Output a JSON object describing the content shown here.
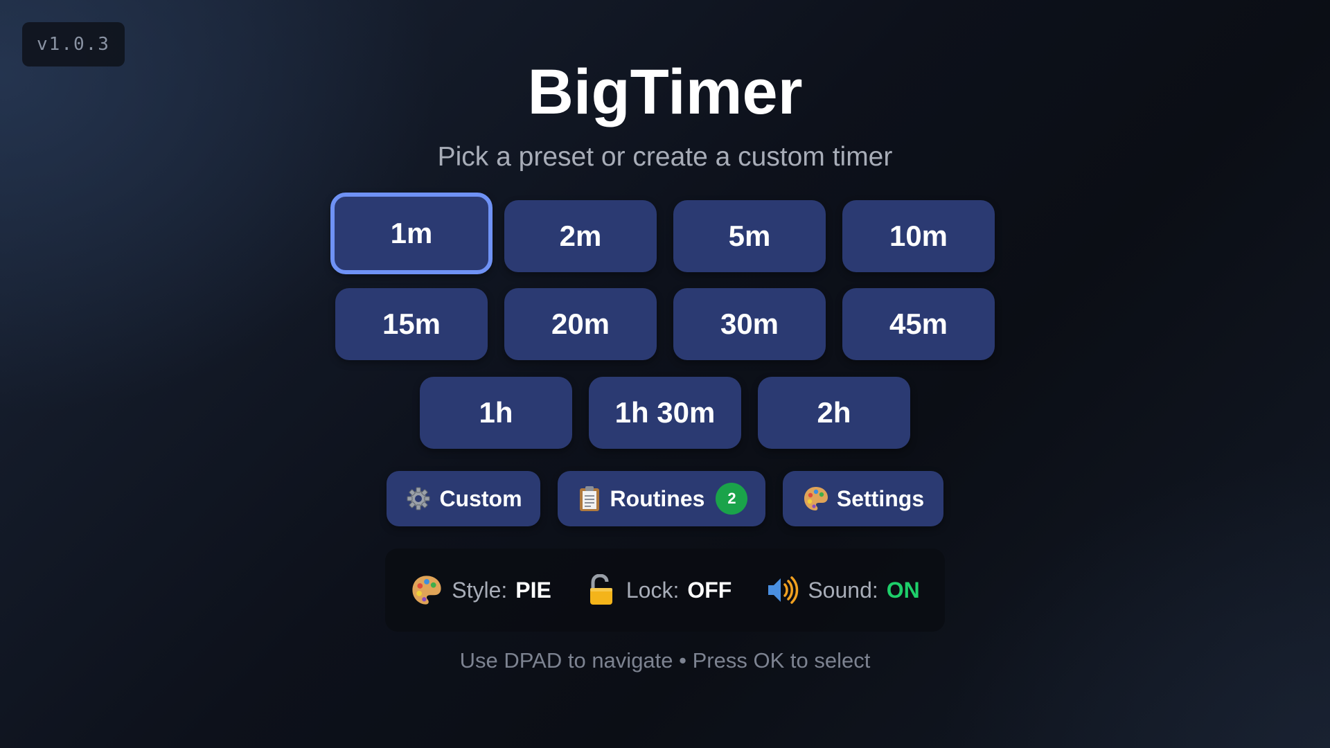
{
  "version": "v1.0.3",
  "header": {
    "title": "BigTimer",
    "subtitle": "Pick a preset or create a custom timer"
  },
  "presets": [
    {
      "label": "1m",
      "focused": true
    },
    {
      "label": "2m"
    },
    {
      "label": "5m"
    },
    {
      "label": "10m"
    },
    {
      "label": "15m"
    },
    {
      "label": "20m"
    },
    {
      "label": "30m"
    },
    {
      "label": "45m"
    },
    {
      "label": "1h"
    },
    {
      "label": "1h 30m"
    },
    {
      "label": "2h"
    }
  ],
  "actions": {
    "custom": {
      "label": "Custom",
      "icon": "gear-icon"
    },
    "routines": {
      "label": "Routines",
      "icon": "clipboard-icon",
      "count": "2"
    },
    "settings": {
      "label": "Settings",
      "icon": "palette-icon"
    }
  },
  "status": {
    "style": {
      "label": "Style:",
      "value": "PIE",
      "icon": "palette-icon"
    },
    "lock": {
      "label": "Lock:",
      "value": "OFF",
      "icon": "unlocked-padlock-icon"
    },
    "sound": {
      "label": "Sound:",
      "value": "ON",
      "icon": "speaker-icon"
    }
  },
  "hint": "Use DPAD to navigate • Press OK to select",
  "colors": {
    "button": "#2b3a72",
    "focus_ring": "#6f92f5",
    "badge_green": "#1aa34a",
    "on_green": "#1ecf6a"
  }
}
